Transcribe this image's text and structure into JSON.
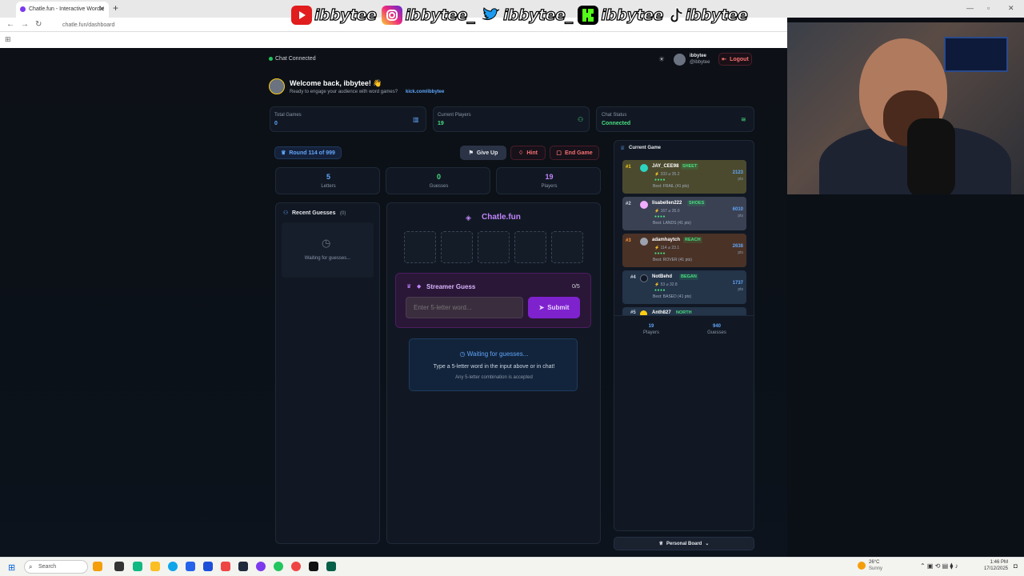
{
  "browser": {
    "tab_title": "Chatle.fun - Interactive Wordle",
    "url": "chatle.fun/dashboard",
    "new_tab": "+",
    "close": "✕"
  },
  "overlay": {
    "socials": [
      {
        "platform": "youtube",
        "handle": "ibbytee",
        "color": "#e11d1d"
      },
      {
        "platform": "instagram",
        "handle": "ibbytee_",
        "color": "#d62976"
      },
      {
        "platform": "twitter",
        "handle": "ibbytee_",
        "color": "#1d9bf0"
      },
      {
        "platform": "kick",
        "handle": "ibbytee",
        "color": "#53fc18"
      },
      {
        "platform": "tiktok",
        "handle": "ibbytee",
        "color": "#111111"
      }
    ]
  },
  "header": {
    "status": "Chat Connected",
    "user_name": "ibbytee",
    "user_handle": "@ibbytee",
    "logout": "Logout"
  },
  "welcome": {
    "title": "Welcome back, ibbytee! 👋",
    "subtitle": "Ready to engage your audience with word games?",
    "link": "kick.com/ibbytee"
  },
  "stats": {
    "total_games_label": "Total Games",
    "total_games_value": "0",
    "current_players_label": "Current Players",
    "current_players_value": "19",
    "chat_status_label": "Chat Status",
    "chat_status_value": "Connected"
  },
  "round": {
    "label": "Round 114 of 999",
    "give_up": "Give Up",
    "hint": "Hint",
    "end_game": "End Game"
  },
  "counters": [
    {
      "value": "5",
      "label": "Letters",
      "color": "#60a5fa"
    },
    {
      "value": "0",
      "label": "Guesses",
      "color": "#4ade80"
    },
    {
      "value": "19",
      "label": "Players",
      "color": "#c084fc"
    }
  ],
  "recent_guesses": {
    "title": "Recent Guesses",
    "count": "(0)",
    "waiting": "Waiting for guesses..."
  },
  "board": {
    "brand": "Chatle.fun",
    "streamer_guess": "Streamer Guess",
    "guess_count": "0/5",
    "input_placeholder": "Enter 5-letter word...",
    "submit": "Submit",
    "waiting_title": "Waiting for guesses...",
    "waiting_text": "Type a 5-letter word in the input above or in chat!",
    "waiting_sub": "Any 5-letter combination is accepted"
  },
  "current_game": {
    "title": "Current Game",
    "players": [
      {
        "rank": "#1",
        "name": "JAY_CEE98",
        "word": "SHEET",
        "stats": "⚡ 333 ⌀ 35.2",
        "best": "Best: FRAIL (41 pts)",
        "pts": "2123",
        "pts_label": "pts",
        "bg": "#4b4a2e",
        "av": "#2dd4bf"
      },
      {
        "rank": "#2",
        "name": "lisabellen222",
        "word": "SHOES",
        "stats": "⚡ 167 ⌀ 35.0",
        "best": "Best: LANDS (41 pts)",
        "pts": "6010",
        "pts_label": "pts",
        "bg": "#3a4152",
        "av": "#f0abfc"
      },
      {
        "rank": "#3",
        "name": "adamhaytch",
        "word": "REACH",
        "stats": "⚡ 114 ⌀ 23.1",
        "best": "Best: ROVER (41 pts)",
        "pts": "2638",
        "pts_label": "pts",
        "bg": "#4a3226",
        "av": "#9ca3af"
      },
      {
        "rank": "#4",
        "name": "NotBehd",
        "word": "BEGAN",
        "stats": "⚡ 53 ⌀ 32.8",
        "best": "Best: BASED (41 pts)",
        "pts": "1737",
        "pts_label": "pts",
        "bg": "#243449",
        "av": "#1f2937"
      },
      {
        "rank": "#5",
        "name": "Anth827",
        "word": "NORTH",
        "stats": "",
        "best": "",
        "pts": "",
        "pts_label": "",
        "bg": "#243449",
        "av": "#facc15"
      }
    ],
    "footer_players_value": "19",
    "footer_players_label": "Players",
    "footer_guesses_value": "940",
    "footer_guesses_label": "Guesses"
  },
  "personal_board": "Personal Board",
  "taskbar": {
    "search": "Search",
    "weather_temp": "26°C",
    "weather_text": "Sunny",
    "time": "1:46 PM",
    "date": "17/12/2025"
  }
}
